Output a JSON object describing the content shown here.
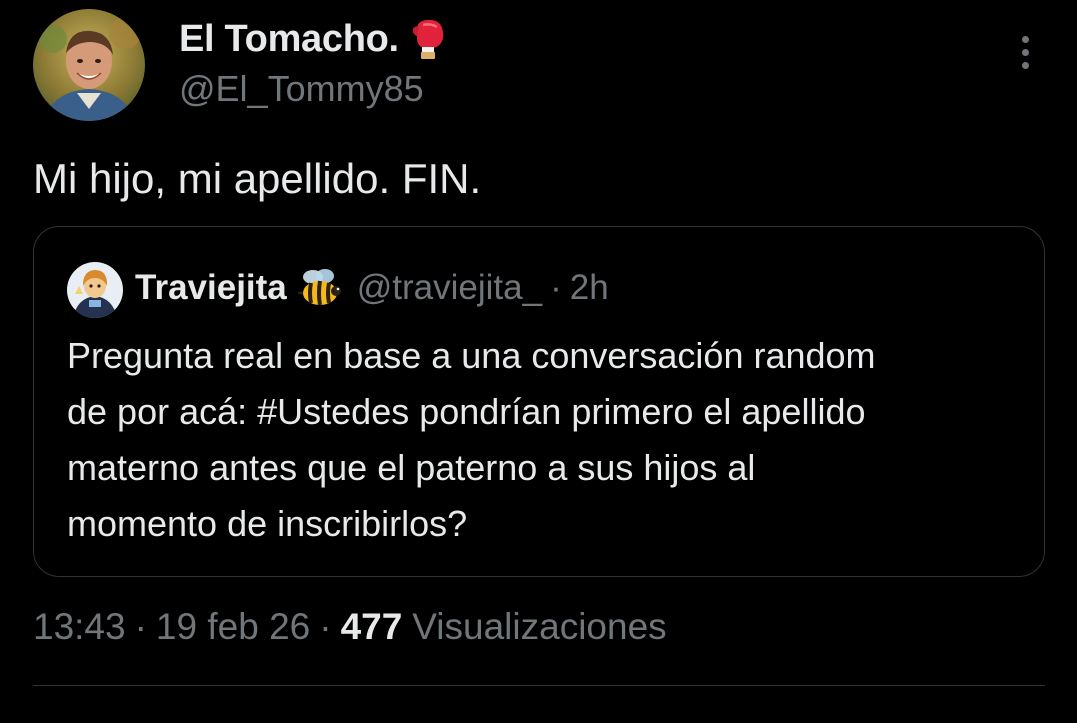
{
  "author": {
    "display_name": "El Tomacho.",
    "name_emoji_icon": "boxing-glove-icon",
    "handle": "@El_Tommy85",
    "avatar_icon": "profile-avatar"
  },
  "tweet": {
    "text": "Mi hijo, mi apellido. FIN."
  },
  "quoted_tweet": {
    "display_name": "Traviejita",
    "name_emoji_icon": "bee-icon",
    "handle": "@traviejita_",
    "separator": "·",
    "time": "2h",
    "text_lines": [
      "Pregunta real en base a una conversación random",
      "de por acá: #Ustedes pondrían primero el apellido",
      "materno antes que el paterno a sus hijos al",
      "momento de inscribirlos?"
    ]
  },
  "meta": {
    "time": "13:43",
    "separator": "·",
    "date": "19 feb 26",
    "view_count": "477",
    "views_label": "Visualizaciones"
  },
  "colors": {
    "background": "#000000",
    "primary_text": "#e7e9ea",
    "secondary_text": "#71767b",
    "border": "#2f3336"
  }
}
